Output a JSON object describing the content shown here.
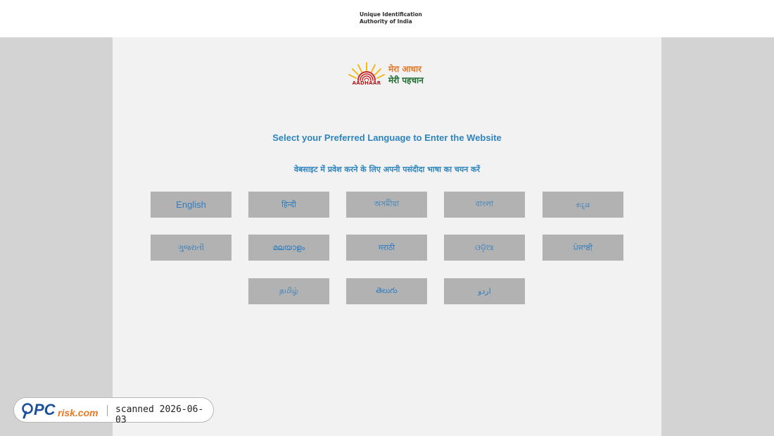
{
  "header": {
    "org_line1": "Unique Identification",
    "org_line2": "Authority of India"
  },
  "logo": {
    "word": "AADHAAR",
    "tagline_line1": "मेरा आधार",
    "tagline_line2": "मेरी पहचान",
    "colors": {
      "sun_red": "#c62828",
      "sun_yellow": "#f5b400",
      "tagline_orange": "#e37a2b",
      "tagline_green": "#1d6b2f"
    }
  },
  "prompt": {
    "english": "Select your Preferred Language to Enter the Website",
    "hindi": "वेबसाइट में प्रवेश करने के लिए अपनी पसंदीदा भाषा का चयन करें"
  },
  "languages": [
    {
      "label": "English"
    },
    {
      "label": "हिन्दी"
    },
    {
      "label": "অসমীয়া"
    },
    {
      "label": "বাংলা"
    },
    {
      "label": "ಕನ್ನಡ"
    },
    {
      "label": "ગુજરાતી"
    },
    {
      "label": "മലയാളം"
    },
    {
      "label": "मराठी"
    },
    {
      "label": "ଓଡ଼ିଆ"
    },
    {
      "label": "ਪੰਜਾਬੀ"
    },
    {
      "label": "தமிழ்"
    },
    {
      "label": "తెలుగు"
    },
    {
      "label": "اردو"
    }
  ],
  "badge": {
    "brand_pc": "PC",
    "brand_risk": "risk.com",
    "scan_text": "scanned 2026-06-03",
    "colors": {
      "brand_blue": "#1b4f9c",
      "brand_orange": "#e87722"
    }
  },
  "colors": {
    "background": "#d3d3d3",
    "panel": "#f2f2f2",
    "button": "#b2b2b2",
    "button_text": "#2e7dc0",
    "prompt_text": "#2d84bd"
  }
}
